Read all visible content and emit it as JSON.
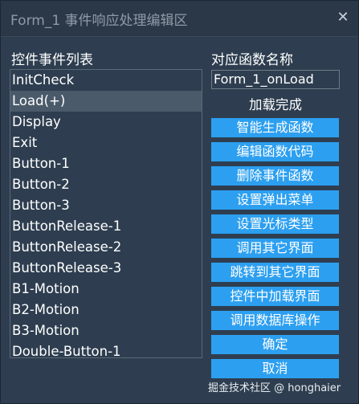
{
  "window": {
    "title": "Form_1 事件响应处理编辑区",
    "close_symbol": "✕"
  },
  "events_panel": {
    "label": "控件事件列表",
    "items": [
      "InitCheck",
      "Load(+)",
      "Display",
      "Exit",
      "Button-1",
      "Button-2",
      "Button-3",
      "ButtonRelease-1",
      "ButtonRelease-2",
      "ButtonRelease-3",
      "B1-Motion",
      "B2-Motion",
      "B3-Motion",
      "Double-Button-1"
    ],
    "selected_index": 1
  },
  "function_panel": {
    "label": "对应函数名称",
    "function_name": "Form_1_onLoad",
    "status": "加载完成"
  },
  "buttons": [
    "智能生成函数",
    "编辑函数代码",
    "删除事件函数",
    "设置弹出菜单",
    "设置光标类型",
    "调用其它界面",
    "跳转到其它界面",
    "控件中加载界面",
    "调用数据库操作",
    "确定",
    "取消"
  ],
  "watermark": "掘金技术社区 @ honghaier",
  "colors": {
    "button_bg": "#2c9ff0",
    "window_bg": "#2e3e50",
    "selection_bg": "#4a5a6a"
  }
}
